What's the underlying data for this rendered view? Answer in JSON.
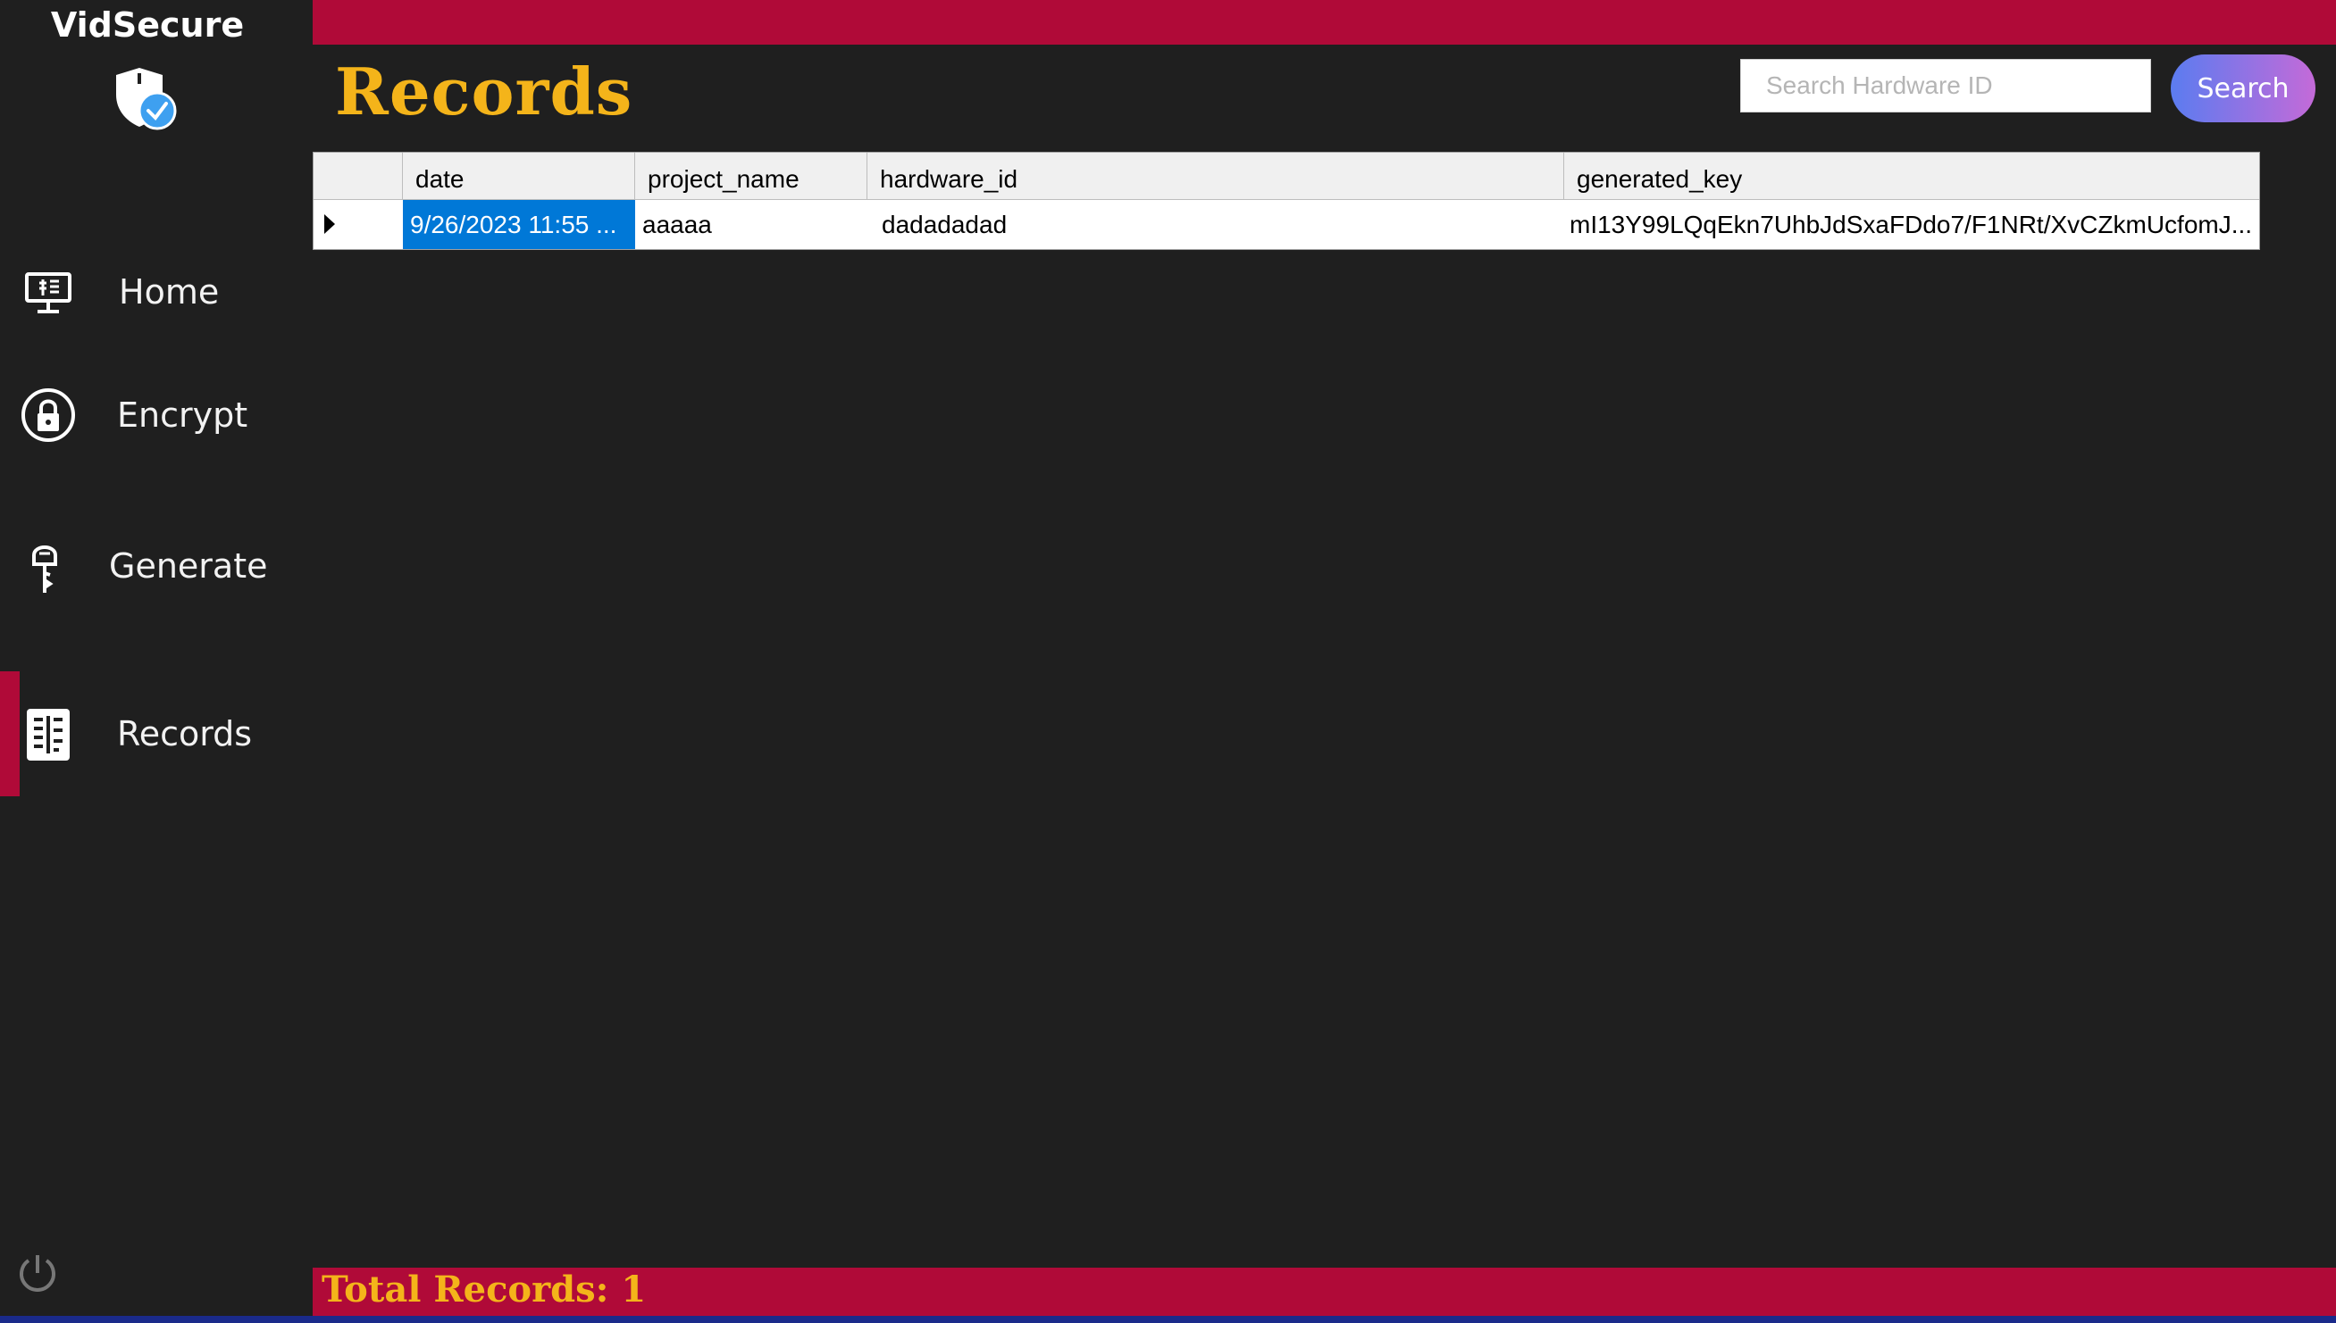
{
  "app": {
    "title": "VidSecure"
  },
  "sidebar": {
    "items": [
      {
        "label": "Home",
        "icon": "monitor-icon"
      },
      {
        "label": "Encrypt",
        "icon": "lock-icon"
      },
      {
        "label": "Generate",
        "icon": "key-icon"
      },
      {
        "label": "Records",
        "icon": "records-icon",
        "active": true
      }
    ],
    "power_icon": "power-icon"
  },
  "header": {
    "title": "Records"
  },
  "search": {
    "placeholder": "Search Hardware ID",
    "value": "",
    "button_label": "Search"
  },
  "table": {
    "columns": [
      "date",
      "project_name",
      "hardware_id",
      "generated_key"
    ],
    "rows": [
      {
        "date": "9/26/2023 11:55 ...",
        "project_name": "aaaaa",
        "hardware_id": "dadadadad",
        "generated_key": "mI13Y99LQqEkn7UhbJdSxaFDdo7/F1NRt/XvCZkmUcfomJ..."
      }
    ]
  },
  "footer": {
    "total_label": "Total Records: 1"
  },
  "colors": {
    "accent_bar": "#b00a38",
    "title_gold": "#f4b41a",
    "background": "#1f1f1f",
    "selection": "#0078d7"
  }
}
